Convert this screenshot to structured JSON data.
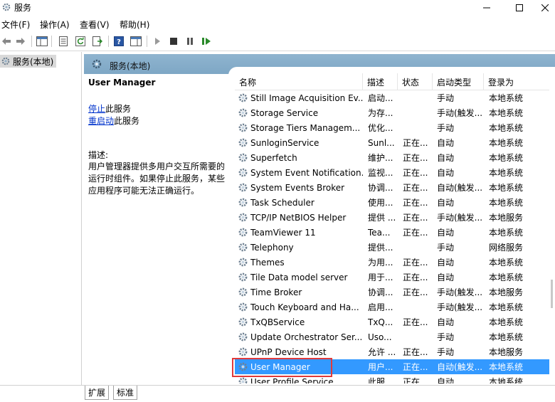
{
  "window": {
    "title": "服务"
  },
  "menu": [
    {
      "label": "文件(F)"
    },
    {
      "label": "操作(A)"
    },
    {
      "label": "查看(V)"
    },
    {
      "label": "帮助(H)"
    }
  ],
  "tree": {
    "root_label": "服务(本地)"
  },
  "panel": {
    "header_label": "服务(本地)"
  },
  "detail": {
    "service_name": "User Manager",
    "stop_link": "停止",
    "stop_suffix": "此服务",
    "restart_link": "重启动",
    "restart_suffix": "此服务",
    "desc_label": "描述:",
    "desc_text": "用户管理器提供多用户交互所需要的运行时组件。如果停止此服务，某些应用程序可能无法正确运行。"
  },
  "columns": [
    {
      "label": "名称"
    },
    {
      "label": "描述"
    },
    {
      "label": "状态"
    },
    {
      "label": "启动类型"
    },
    {
      "label": "登录为"
    }
  ],
  "services": [
    {
      "name": "Still Image Acquisition Ev...",
      "desc": "启动...",
      "status": "",
      "startup": "手动",
      "logon": "本地系统"
    },
    {
      "name": "Storage Service",
      "desc": "为存...",
      "status": "",
      "startup": "手动(触发...",
      "logon": "本地系统"
    },
    {
      "name": "Storage Tiers Managem...",
      "desc": "优化...",
      "status": "",
      "startup": "手动",
      "logon": "本地系统"
    },
    {
      "name": "SunloginService",
      "desc": "Sunl...",
      "status": "正在...",
      "startup": "自动",
      "logon": "本地系统"
    },
    {
      "name": "Superfetch",
      "desc": "维护...",
      "status": "正在...",
      "startup": "自动",
      "logon": "本地系统"
    },
    {
      "name": "System Event Notification...",
      "desc": "监视...",
      "status": "正在...",
      "startup": "自动",
      "logon": "本地系统"
    },
    {
      "name": "System Events Broker",
      "desc": "协调...",
      "status": "正在...",
      "startup": "自动(触发...",
      "logon": "本地系统"
    },
    {
      "name": "Task Scheduler",
      "desc": "使用...",
      "status": "正在...",
      "startup": "自动",
      "logon": "本地系统"
    },
    {
      "name": "TCP/IP NetBIOS Helper",
      "desc": "提供 ...",
      "status": "正在...",
      "startup": "手动(触发...",
      "logon": "本地服务"
    },
    {
      "name": "TeamViewer 11",
      "desc": "Tea...",
      "status": "正在...",
      "startup": "自动",
      "logon": "本地系统"
    },
    {
      "name": "Telephony",
      "desc": "提供...",
      "status": "",
      "startup": "手动",
      "logon": "网络服务"
    },
    {
      "name": "Themes",
      "desc": "为用...",
      "status": "正在...",
      "startup": "自动",
      "logon": "本地系统"
    },
    {
      "name": "Tile Data model server",
      "desc": "用于...",
      "status": "正在...",
      "startup": "自动",
      "logon": "本地系统"
    },
    {
      "name": "Time Broker",
      "desc": "协调...",
      "status": "正在...",
      "startup": "手动(触发...",
      "logon": "本地服务"
    },
    {
      "name": "Touch Keyboard and Ha...",
      "desc": "启用...",
      "status": "",
      "startup": "手动(触发...",
      "logon": "本地系统"
    },
    {
      "name": "TxQBService",
      "desc": "TxQ...",
      "status": "正在...",
      "startup": "自动",
      "logon": "本地系统"
    },
    {
      "name": "Update Orchestrator Ser...",
      "desc": "Uso...",
      "status": "",
      "startup": "手动",
      "logon": "本地系统"
    },
    {
      "name": "UPnP Device Host",
      "desc": "允许 ...",
      "status": "正在...",
      "startup": "手动",
      "logon": "本地服务"
    },
    {
      "name": "User Manager",
      "desc": "用户...",
      "status": "正在...",
      "startup": "自动(触发...",
      "logon": "本地系统",
      "selected": true
    },
    {
      "name": "User Profile Service",
      "desc": "此服...",
      "status": "正在...",
      "startup": "自动",
      "logon": "本地系统"
    }
  ],
  "bottom_tabs": [
    {
      "label": "扩展"
    },
    {
      "label": "标准"
    }
  ],
  "colors": {
    "selection": "#3399ff",
    "header_bar": "#8fb4cf",
    "highlight_box": "#e03a3a",
    "link": "#0033cc"
  }
}
